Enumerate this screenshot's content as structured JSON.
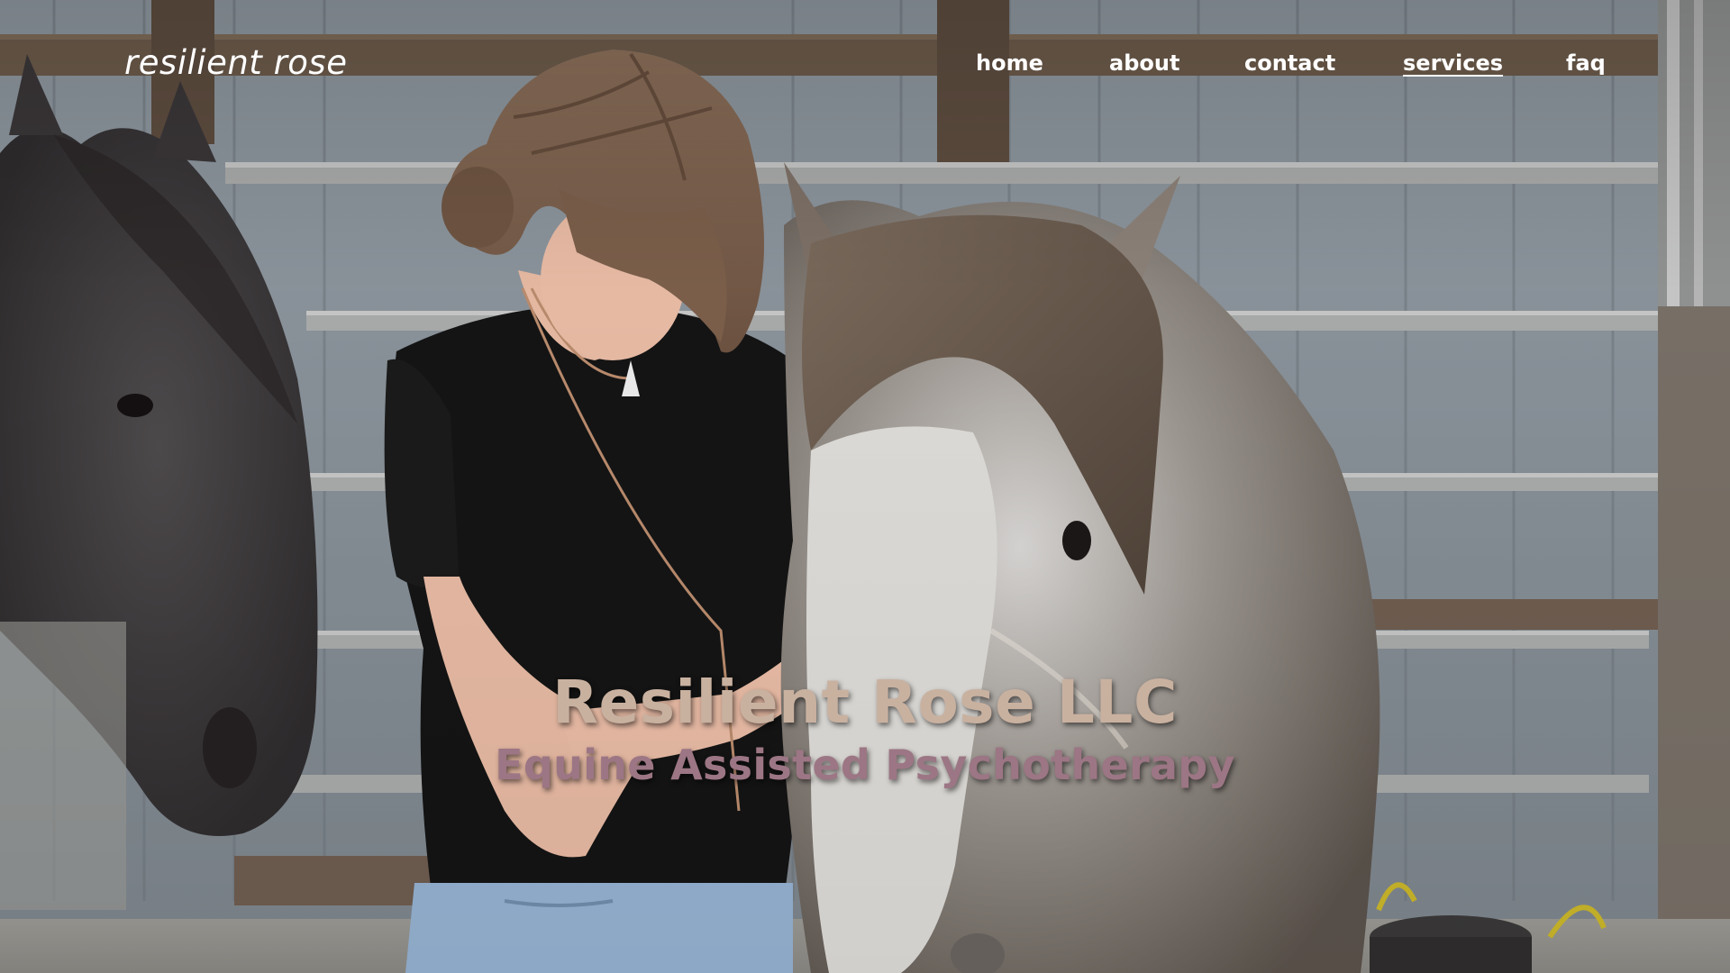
{
  "header": {
    "logo_text": "resilient rose"
  },
  "nav": {
    "items": [
      {
        "label": "home",
        "active": false
      },
      {
        "label": "about",
        "active": false
      },
      {
        "label": "contact",
        "active": false
      },
      {
        "label": "services",
        "active": true
      },
      {
        "label": "faq",
        "active": false
      }
    ]
  },
  "hero": {
    "title": "Resilient Rose LLC",
    "subtitle": "Equine Assisted Psychotherapy",
    "image_description_icon": "photo-woman-with-horses"
  },
  "colors": {
    "nav_text": "#ffffff",
    "title": "#c9b1a0",
    "subtitle": "#9c7684"
  }
}
